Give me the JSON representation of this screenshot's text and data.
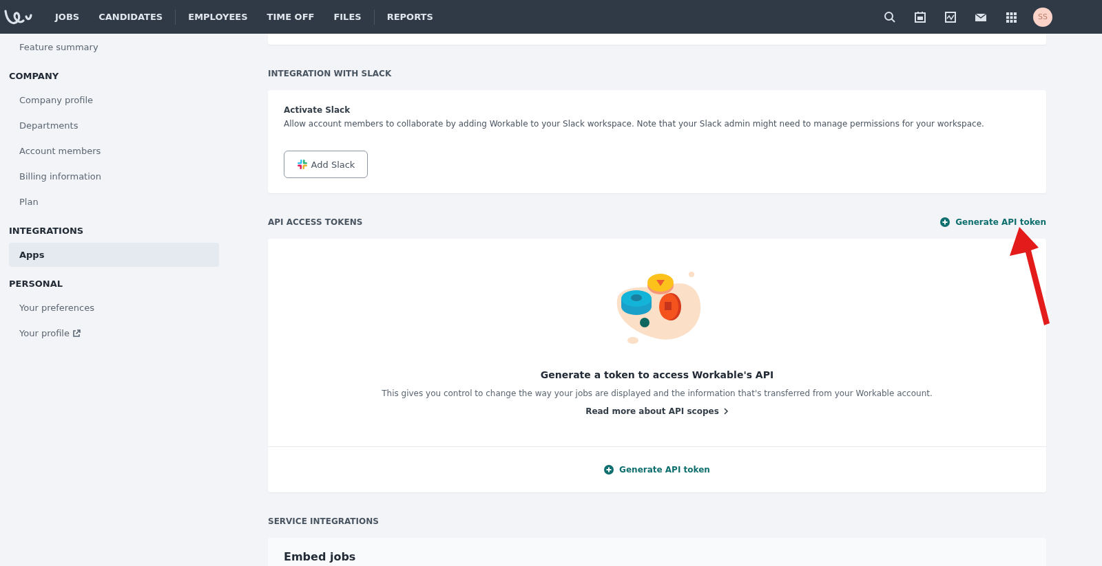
{
  "top_nav": {
    "groups": [
      [
        "JOBS",
        "CANDIDATES"
      ],
      [
        "EMPLOYEES",
        "TIME OFF",
        "FILES"
      ],
      [
        "REPORTS"
      ]
    ],
    "avatar": "SS"
  },
  "sidebar": {
    "sections": [
      {
        "items": [
          {
            "label": "Feature summary",
            "selected": false,
            "external": false
          }
        ]
      },
      {
        "heading": "COMPANY",
        "items": [
          {
            "label": "Company profile",
            "selected": false,
            "external": false
          },
          {
            "label": "Departments",
            "selected": false,
            "external": false
          },
          {
            "label": "Account members",
            "selected": false,
            "external": false
          },
          {
            "label": "Billing information",
            "selected": false,
            "external": false
          },
          {
            "label": "Plan",
            "selected": false,
            "external": false
          }
        ]
      },
      {
        "heading": "INTEGRATIONS",
        "items": [
          {
            "label": "Apps",
            "selected": true,
            "external": false
          }
        ]
      },
      {
        "heading": "PERSONAL",
        "items": [
          {
            "label": "Your preferences",
            "selected": false,
            "external": false
          },
          {
            "label": "Your profile",
            "selected": false,
            "external": true
          }
        ]
      }
    ]
  },
  "slack": {
    "heading": "INTEGRATION WITH SLACK",
    "title": "Activate Slack",
    "description": "Allow account members to collaborate by adding Workable to your Slack workspace. Note that your Slack admin might need to manage permissions for your workspace.",
    "button": "Add Slack"
  },
  "api_tokens": {
    "heading": "API ACCESS TOKENS",
    "header_action": "Generate API token",
    "empty_title": "Generate a token to access Workable's API",
    "empty_description": "This gives you control to change the way your jobs are displayed and the information that's transferred from your Workable account.",
    "read_more": "Read more about API scopes",
    "footer_action": "Generate API token"
  },
  "service_integrations": {
    "heading": "SERVICE INTEGRATIONS",
    "cards": [
      "Embed jobs"
    ]
  }
}
